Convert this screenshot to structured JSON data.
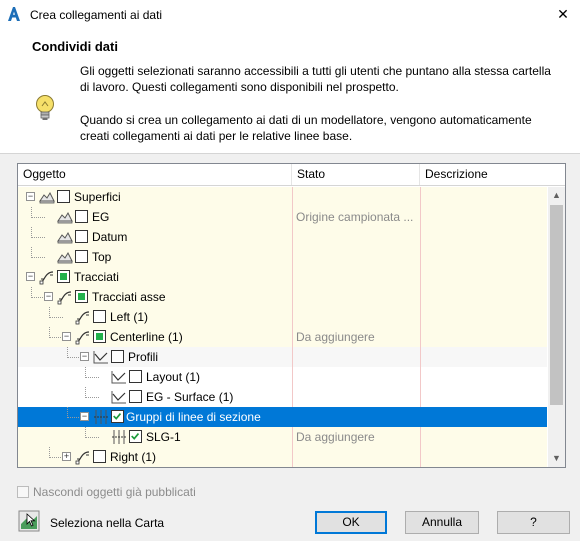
{
  "window": {
    "title": "Crea collegamenti ai dati",
    "close_symbol": "✕",
    "icon": "autocad-a-icon",
    "accent_color": "#0078d7"
  },
  "header": {
    "title": "Condividi dati",
    "paragraph1": "Gli oggetti selezionati saranno accessibili a tutti gli utenti che puntano alla stessa cartella di lavoro. Questi collegamenti sono disponibili nel prospetto.",
    "paragraph2": "Quando si crea un collegamento ai dati di un modellatore, vengono automaticamente creati collegamenti ai dati per le relative linee base.",
    "icon": "lightbulb-icon"
  },
  "tree": {
    "columns": [
      "Oggetto",
      "Stato",
      "Descrizione"
    ],
    "rows": [
      {
        "label": "Superfici",
        "stato": "",
        "level": 0,
        "checkbox": "unchecked",
        "expander": "minus",
        "icon": "surface-icon"
      },
      {
        "label": "EG",
        "stato": "Origine campionata ...",
        "level": 1,
        "checkbox": "unchecked",
        "expander": "",
        "icon": "surface-icon"
      },
      {
        "label": "Datum",
        "stato": "",
        "level": 1,
        "checkbox": "unchecked",
        "expander": "",
        "icon": "surface-icon"
      },
      {
        "label": "Top",
        "stato": "",
        "level": 1,
        "checkbox": "unchecked",
        "expander": "",
        "icon": "surface-icon"
      },
      {
        "label": "Tracciati",
        "stato": "",
        "level": 0,
        "checkbox": "partial",
        "expander": "minus",
        "icon": "alignment-icon"
      },
      {
        "label": "Tracciati asse",
        "stato": "",
        "level": 1,
        "checkbox": "partial",
        "expander": "minus",
        "icon": "alignment-icon"
      },
      {
        "label": "Left (1)",
        "stato": "",
        "level": 2,
        "checkbox": "unchecked",
        "expander": "",
        "icon": "alignment-icon"
      },
      {
        "label": "Centerline (1)",
        "stato": "Da aggiungere",
        "level": 2,
        "checkbox": "partial",
        "expander": "minus",
        "icon": "alignment-icon"
      },
      {
        "label": "Profili",
        "stato": "",
        "level": 3,
        "checkbox": "unchecked",
        "expander": "minus",
        "icon": "profile-icon"
      },
      {
        "label": "Layout (1)",
        "stato": "",
        "level": 4,
        "checkbox": "unchecked",
        "expander": "",
        "icon": "profile-icon"
      },
      {
        "label": "EG - Surface (1)",
        "stato": "",
        "level": 4,
        "checkbox": "unchecked",
        "expander": "",
        "icon": "profile-icon"
      },
      {
        "label": "Gruppi di linee di sezione",
        "stato": "",
        "level": 3,
        "checkbox": "checked",
        "expander": "minus",
        "icon": "sample-line-icon",
        "selected": true
      },
      {
        "label": "SLG-1",
        "stato": "Da aggiungere",
        "level": 4,
        "checkbox": "checked",
        "expander": "",
        "icon": "sample-line-icon"
      },
      {
        "label": "Right (1)",
        "stato": "",
        "level": 2,
        "checkbox": "unchecked",
        "expander": "plus",
        "icon": "alignment-icon"
      }
    ]
  },
  "footer": {
    "hide_published_label": "Nascondi oggetti già pubblicati",
    "select_in_map_label": "Seleziona nella Carta",
    "ok_label": "OK",
    "cancel_label": "Annulla",
    "help_label": "?"
  }
}
